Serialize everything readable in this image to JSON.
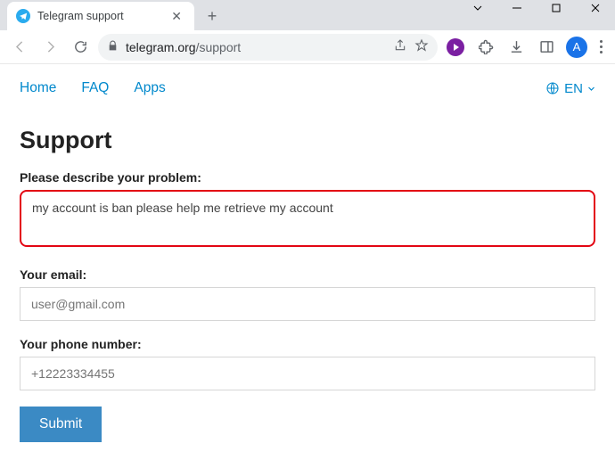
{
  "window": {
    "tab_title": "Telegram support",
    "newtab_tooltip": "+"
  },
  "toolbar": {
    "url_domain": "telegram.org",
    "url_path": "/support",
    "avatar_letter": "A"
  },
  "nav": {
    "home": "Home",
    "faq": "FAQ",
    "apps": "Apps",
    "lang": "EN"
  },
  "form": {
    "heading": "Support",
    "problem_label": "Please describe your problem:",
    "problem_value": "my account is ban please help me retrieve my account",
    "email_label": "Your email:",
    "email_placeholder": "user@gmail.com",
    "phone_label": "Your phone number:",
    "phone_placeholder": "+12223334455",
    "submit_label": "Submit"
  }
}
